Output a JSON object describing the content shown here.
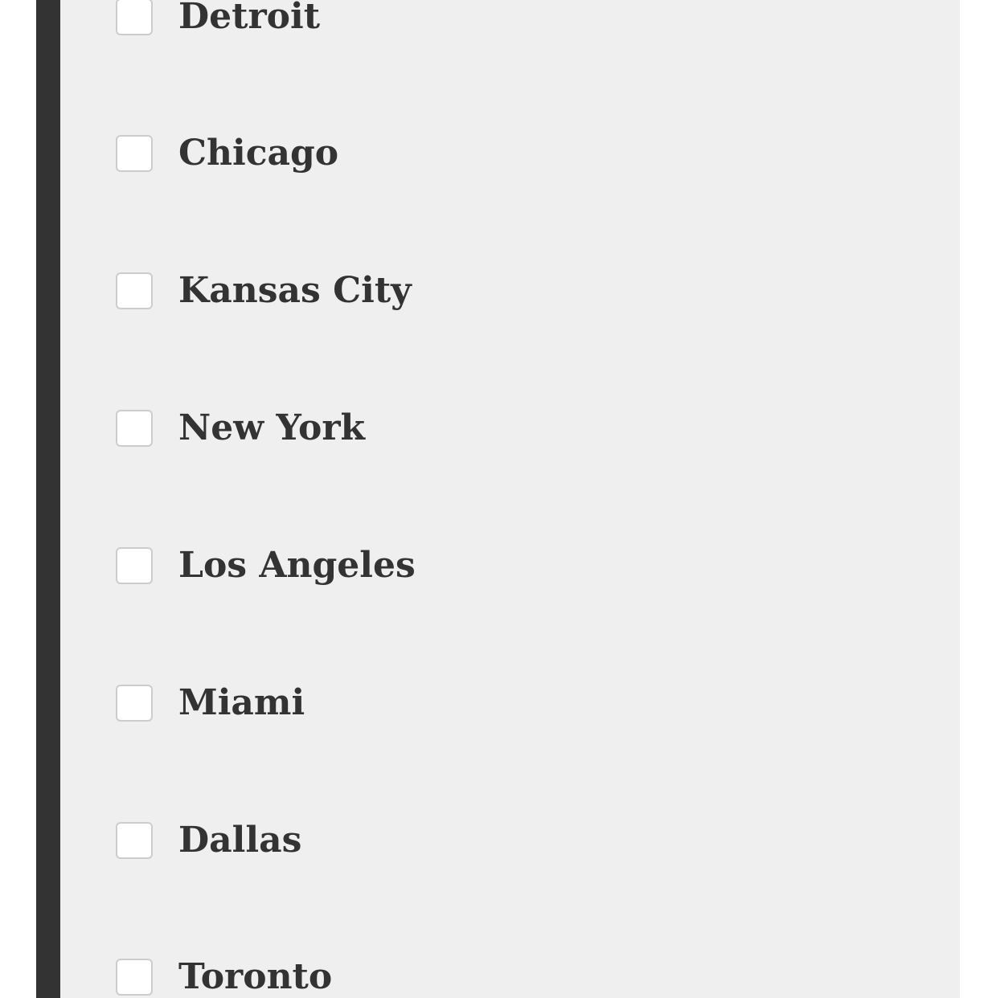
{
  "colors": {
    "panel_background": "#efefef",
    "panel_border": "#333333",
    "text": "#333333",
    "checkbox_border": "#cccccc",
    "checkbox_fill": "#ffffff"
  },
  "cities": {
    "items": [
      {
        "label": "Detroit",
        "checked": false
      },
      {
        "label": "Chicago",
        "checked": false
      },
      {
        "label": "Kansas City",
        "checked": false
      },
      {
        "label": "New York",
        "checked": false
      },
      {
        "label": "Los Angeles",
        "checked": false
      },
      {
        "label": "Miami",
        "checked": false
      },
      {
        "label": "Dallas",
        "checked": false
      },
      {
        "label": "Toronto",
        "checked": false
      }
    ]
  }
}
